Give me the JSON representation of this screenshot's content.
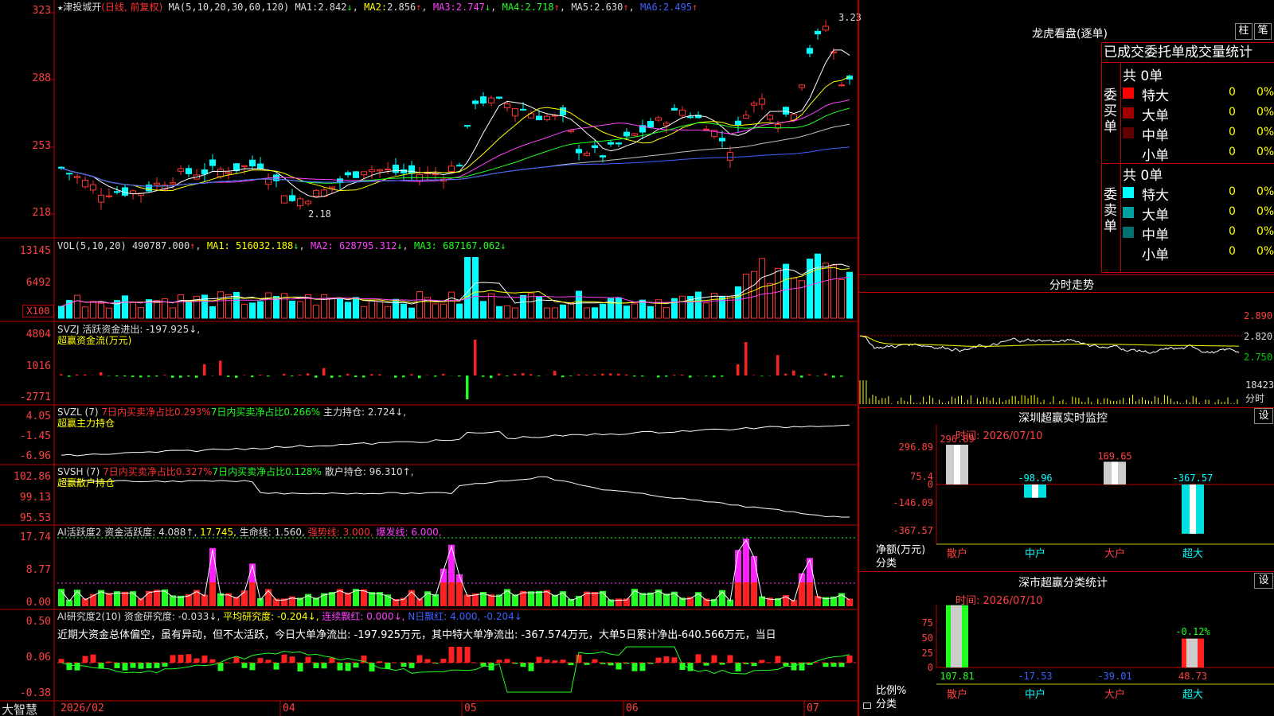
{
  "app_name": "大智慧",
  "stock": {
    "star": "★",
    "name": "津投城开",
    "period": "(日线, 前复权)"
  },
  "ma_header": {
    "params": "MA(5,10,20,30,60,120)",
    "items": [
      {
        "label": "MA1:",
        "value": "2.842",
        "arrow": "↓",
        "color": "#ffffff"
      },
      {
        "label": "MA2:",
        "value": "2.856",
        "arrow": "↑",
        "color": "#ffff00"
      },
      {
        "label": "MA3:",
        "value": "2.747",
        "arrow": "↓",
        "color": "#ff40ff"
      },
      {
        "label": "MA4:",
        "value": "2.718",
        "arrow": "↑",
        "color": "#20ff20"
      },
      {
        "label": "MA5:",
        "value": "2.630",
        "arrow": "↑",
        "color": "#c0c0c0"
      },
      {
        "label": "MA6:",
        "value": "2.495",
        "arrow": "↑",
        "color": "#4060ff"
      }
    ]
  },
  "price_axis": [
    "323",
    "288",
    "253",
    "218"
  ],
  "price_high_label": "3.23",
  "price_low_label": "2.18",
  "vol_header": {
    "params": "VOL(5,10,20)",
    "value": "490787.000",
    "ma1": "MA1: 516032.188",
    "ma2": "MA2: 628795.312",
    "ma3": "MA3: 687167.062"
  },
  "vol_axis": [
    "13145",
    "6492",
    "X100"
  ],
  "svzj": {
    "line1": "SVZJ  活跃资金进出: -197.925↓,",
    "line2": "超赢资金流(万元)",
    "axis": [
      "4804",
      "1016",
      "-2771"
    ]
  },
  "svzl": {
    "name": "SVZL (7)",
    "t1": "7日内买卖净占比0.293%",
    "t2": "7日内买卖净占比0.266%",
    "t3": "主力持仓: 2.724↓,",
    "line2": "超赢主力持仓",
    "axis": [
      "4.05",
      "-1.45",
      "-6.96"
    ]
  },
  "svsh": {
    "name": "SVSH (7)",
    "t1": "7日内买卖净占比0.327%",
    "t2": "7日内买卖净占比0.128%",
    "t3": "散户持仓: 96.310↑,",
    "line2": "超赢散户持仓",
    "axis": [
      "102.86",
      "99.13",
      "95.53"
    ]
  },
  "ai_active": {
    "name": "AI活跃度2",
    "t1": "资金活跃度: 4.088↑,",
    "t2": "17.745,",
    "t3": "生命线: 1.560,",
    "t4": "强势线: 3.000,",
    "t5": "爆发线: 6.000,",
    "axis": [
      "17.74",
      "8.77",
      "0.00"
    ]
  },
  "ai_research": {
    "name": "AI研究度2(10)",
    "t1": "资金研究度: -0.033↓,",
    "t2": "平均研究度: -0.204↓,",
    "t3": "连续飘红: 0.000↓,",
    "t4": "N日飘红: 4.000, -0.204↓",
    "comment": "近期大资金总体偏空，虽有异动，但不太活跃，今日大单净流出: -197.925万元，其中特大单净流出: -367.574万元，大单5日累计净出-640.566万元，当日",
    "axis": [
      "0.50",
      "0.06",
      "-0.38"
    ]
  },
  "date_axis": [
    "2026/02",
    "04",
    "05",
    "06",
    "07"
  ],
  "dragon_tiger": {
    "title": "龙虎看盘(逐单)",
    "btn1": "柱",
    "btn2": "笔",
    "tabs": "已成交委托单成交量统计",
    "buy_label": "委买单",
    "sell_label": "委卖单",
    "buy_total": "共 0单",
    "sell_total": "共 0单",
    "buy_rows": [
      {
        "label": "特大",
        "count": "0",
        "pct": "0%",
        "color": "#ff0000"
      },
      {
        "label": "大单",
        "count": "0",
        "pct": "0%",
        "color": "#a00000"
      },
      {
        "label": "中单",
        "count": "0",
        "pct": "0%",
        "color": "#600000"
      },
      {
        "label": "小单",
        "count": "0",
        "pct": "0%",
        "color": "#000000"
      }
    ],
    "sell_rows": [
      {
        "label": "特大",
        "count": "0",
        "pct": "0%",
        "color": "#00ffff"
      },
      {
        "label": "大单",
        "count": "0",
        "pct": "0%",
        "color": "#00a0a0"
      },
      {
        "label": "中单",
        "count": "0",
        "pct": "0%",
        "color": "#007070"
      },
      {
        "label": "小单",
        "count": "0",
        "pct": "0%",
        "color": "#000000"
      }
    ]
  },
  "intraday": {
    "title": "分时走势",
    "axis": [
      "2.890",
      "2.820",
      "2.750"
    ],
    "vol_label": "18423",
    "vol_label2": "分时"
  },
  "sz_monitor": {
    "title": "深圳超赢实时监控",
    "btn": "设",
    "time": "时间: 2026/07/10",
    "axis": [
      "296.89",
      "75.4",
      "0",
      "-146.09",
      "-367.57"
    ],
    "ylabel1": "净额(万元)",
    "ylabel2": "分类",
    "categories": [
      "散户",
      "中户",
      "大户",
      "超大"
    ],
    "values": [
      "296.89",
      "-98.96",
      "169.65",
      "-367.57"
    ]
  },
  "sz_class": {
    "title": "深市超赢分类统计",
    "btn": "设",
    "time": "时间: 2026/07/10",
    "axis": [
      "75",
      "50",
      "25",
      "0"
    ],
    "ylabel1": "比例%",
    "ylabel2": "分类",
    "categories": [
      "散户",
      "中户",
      "大户",
      "超大"
    ],
    "values": [
      "107.81",
      "-17.53",
      "-39.01",
      "48.73"
    ],
    "top_label": "-0.12%"
  },
  "chart_data": [
    {
      "type": "bar",
      "title": "深圳超赢实时监控",
      "categories": [
        "散户",
        "中户",
        "大户",
        "超大"
      ],
      "values": [
        296.89,
        -98.96,
        169.65,
        -367.57
      ],
      "ylabel": "净额(万元)",
      "ylim": [
        -367.57,
        296.89
      ]
    },
    {
      "type": "bar",
      "title": "深市超赢分类统计",
      "categories": [
        "散户",
        "中户",
        "大户",
        "超大"
      ],
      "values": [
        107.81,
        -17.53,
        -39.01,
        48.73
      ],
      "ylabel": "比例%",
      "ylim": [
        0,
        75
      ]
    }
  ]
}
